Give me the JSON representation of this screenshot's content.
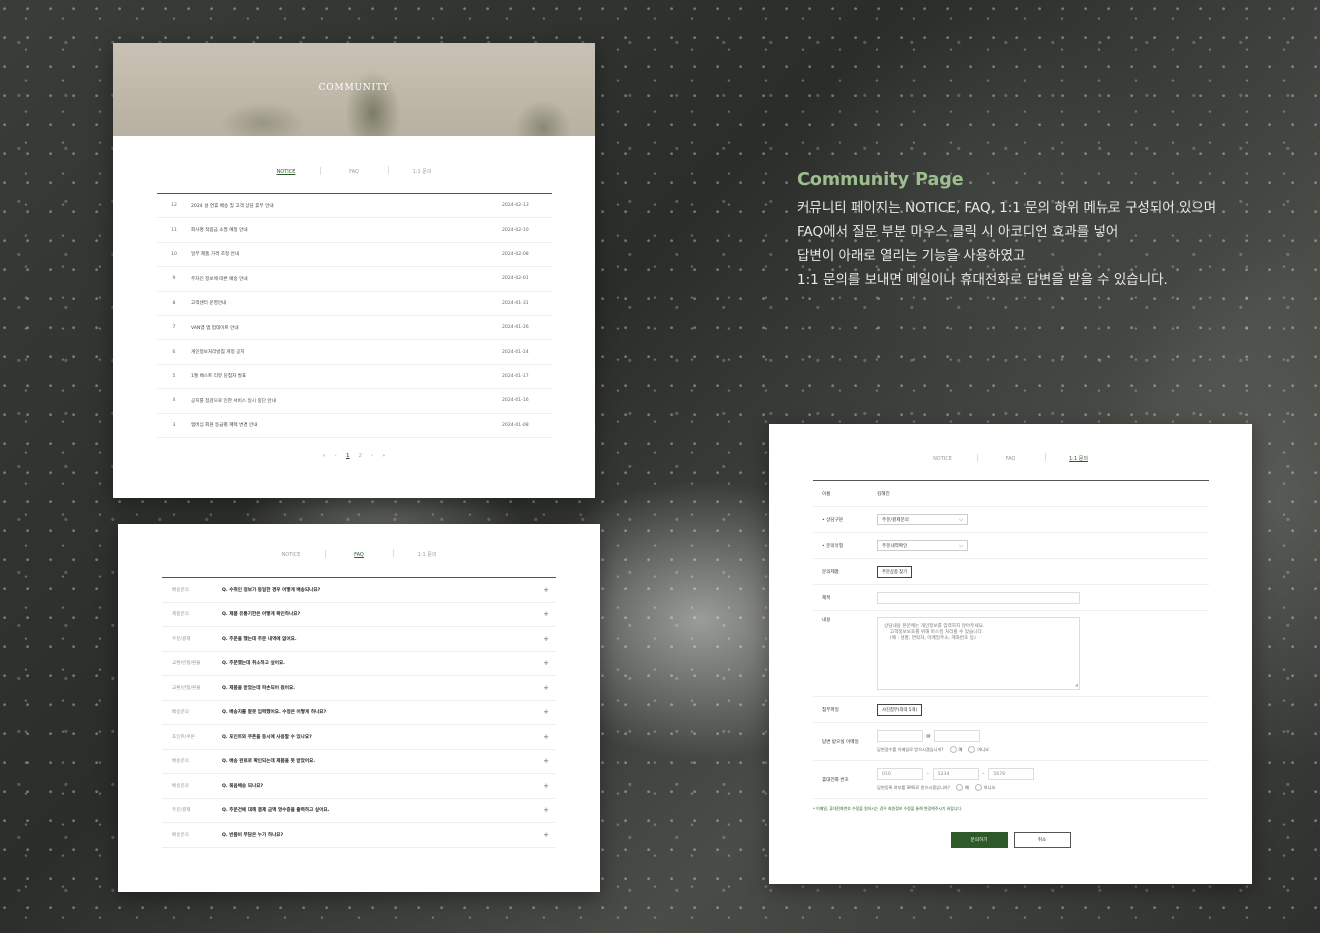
{
  "colors": {
    "accent": "#2e5a2a",
    "title_green": "#9fbe8f"
  },
  "description": {
    "title": "Community Page",
    "lines": [
      "커뮤니티 페이지는 NOTICE, FAQ, 1:1 문의 하위 메뉴로 구성되어 있으며",
      "FAQ에서 질문 부분 마우스 클릭 시 아코디언 효과를 넣어",
      "답변이 아래로 열리는 기능을 사용하였고",
      "1:1 문의를 보내면 메일이나 휴대전화로 답변을 받을 수 있습니다."
    ]
  },
  "tabs": {
    "notice": "NOTICE",
    "faq": "FAQ",
    "inquiry": "1:1 문의"
  },
  "notice": {
    "hero_title": "COMMUNITY",
    "rows": [
      {
        "num": "12",
        "title": "2024 설 연휴 배송 및 고객 상담 휴무 안내",
        "date": "2024-02-13"
      },
      {
        "num": "11",
        "title": "회사명 적립금 소멸 예정 안내",
        "date": "2024-02-10"
      },
      {
        "num": "10",
        "title": "일부 제품 가격 조정 안내",
        "date": "2024-02-08"
      },
      {
        "num": "9",
        "title": "주차인 정보에 따른 배송 안내",
        "date": "2024-02-01"
      },
      {
        "num": "8",
        "title": "고객센터 운영안내",
        "date": "2024-01-31"
      },
      {
        "num": "7",
        "title": "VAN앱 앱 업데이트 안내",
        "date": "2024-01-26"
      },
      {
        "num": "6",
        "title": "개인정보처리방침 개정 공지",
        "date": "2024-01-24"
      },
      {
        "num": "5",
        "title": "1월 베스트 리뷰 당첨자 발표",
        "date": "2024-01-17"
      },
      {
        "num": "4",
        "title": "공지를 점검으로 인한 서비스 일시 중단 안내",
        "date": "2024-01-16"
      },
      {
        "num": "3",
        "title": "멤버십 회원 등급별 혜택 변경 안내",
        "date": "2024-01-08"
      }
    ],
    "pager": {
      "first": "«",
      "prev": "‹",
      "pages": [
        "1",
        "2"
      ],
      "next": "›",
      "last": "»"
    }
  },
  "faq": {
    "rows": [
      {
        "cat": "배송문의",
        "q": "Q. 수취인 정보가 동일한 경우 어떻게 배송되나요?"
      },
      {
        "cat": "제품문의",
        "q": "Q. 제품 유통기한은 어떻게 확인하나요?"
      },
      {
        "cat": "주문/결제",
        "q": "Q. 주문을 했는데 주문 내역에 없어요."
      },
      {
        "cat": "교환/반품/환불",
        "q": "Q. 주문했는데 취소하고 싶어요."
      },
      {
        "cat": "교환/반품/환불",
        "q": "Q. 제품을 받았는데 파손되어 왔어요."
      },
      {
        "cat": "배송문의",
        "q": "Q. 배송지를 잘못 입력했어요. 수정은 어떻게 하나요?"
      },
      {
        "cat": "포인트/쿠폰",
        "q": "Q. 포인트와 쿠폰을 동시에 사용할 수 있나요?"
      },
      {
        "cat": "배송문의",
        "q": "Q. 배송 완료로 확인되는데 제품을 못 받았어요."
      },
      {
        "cat": "배송문의",
        "q": "Q. 묶음배송 되나요?"
      },
      {
        "cat": "주문/결제",
        "q": "Q. 주문건에 대해 결제 금액 영수증을 출력하고 싶어요."
      },
      {
        "cat": "배송문의",
        "q": "Q. 반품비 부담은 누가 하나요?"
      }
    ],
    "expand_icon": "+"
  },
  "inquiry": {
    "fields": {
      "name_label": "이름",
      "name_value": "김해진",
      "consult_label": "상담구분",
      "consult_value": "주문/결제문의",
      "type_label": "문의유형",
      "type_value": "주문내역확인",
      "order_label": "문의제품",
      "order_button": "주문상품 찾기",
      "subject_label": "제목",
      "content_label": "내용",
      "content_placeholder": "상담내용 본문에는 개인정보를 입력하지 않아주세요.\n    고객정보보호를 위해 마스킹 처리될 수 있습니다.\n    (예 : 성명, 연락처, 이메일주소, 계좌번호 등)",
      "attach_label": "첨부파일",
      "attach_button": "사진첨부(최대 5개)",
      "email_label": "답변 받으실 이메일",
      "email_at": "@",
      "email_question": "답변접수를 이메일로 받으시겠습니까?",
      "email_yes": "예",
      "email_no": "아니오",
      "phone_label": "휴대전화 번호",
      "phone_1": "010",
      "phone_2": "1234",
      "phone_3": "5678",
      "phone_dash": "-",
      "phone_question": "답변등록 여부를 SMS로 받으시겠습니까?",
      "phone_yes": "예",
      "phone_no": "아니오"
    },
    "note": "* 이메일, 휴대전화번호 수정을 원하시는 경우 회원정보 수정을 통해 변경해주시기 바랍니다.",
    "submit": "문의하기",
    "cancel": "취소"
  }
}
